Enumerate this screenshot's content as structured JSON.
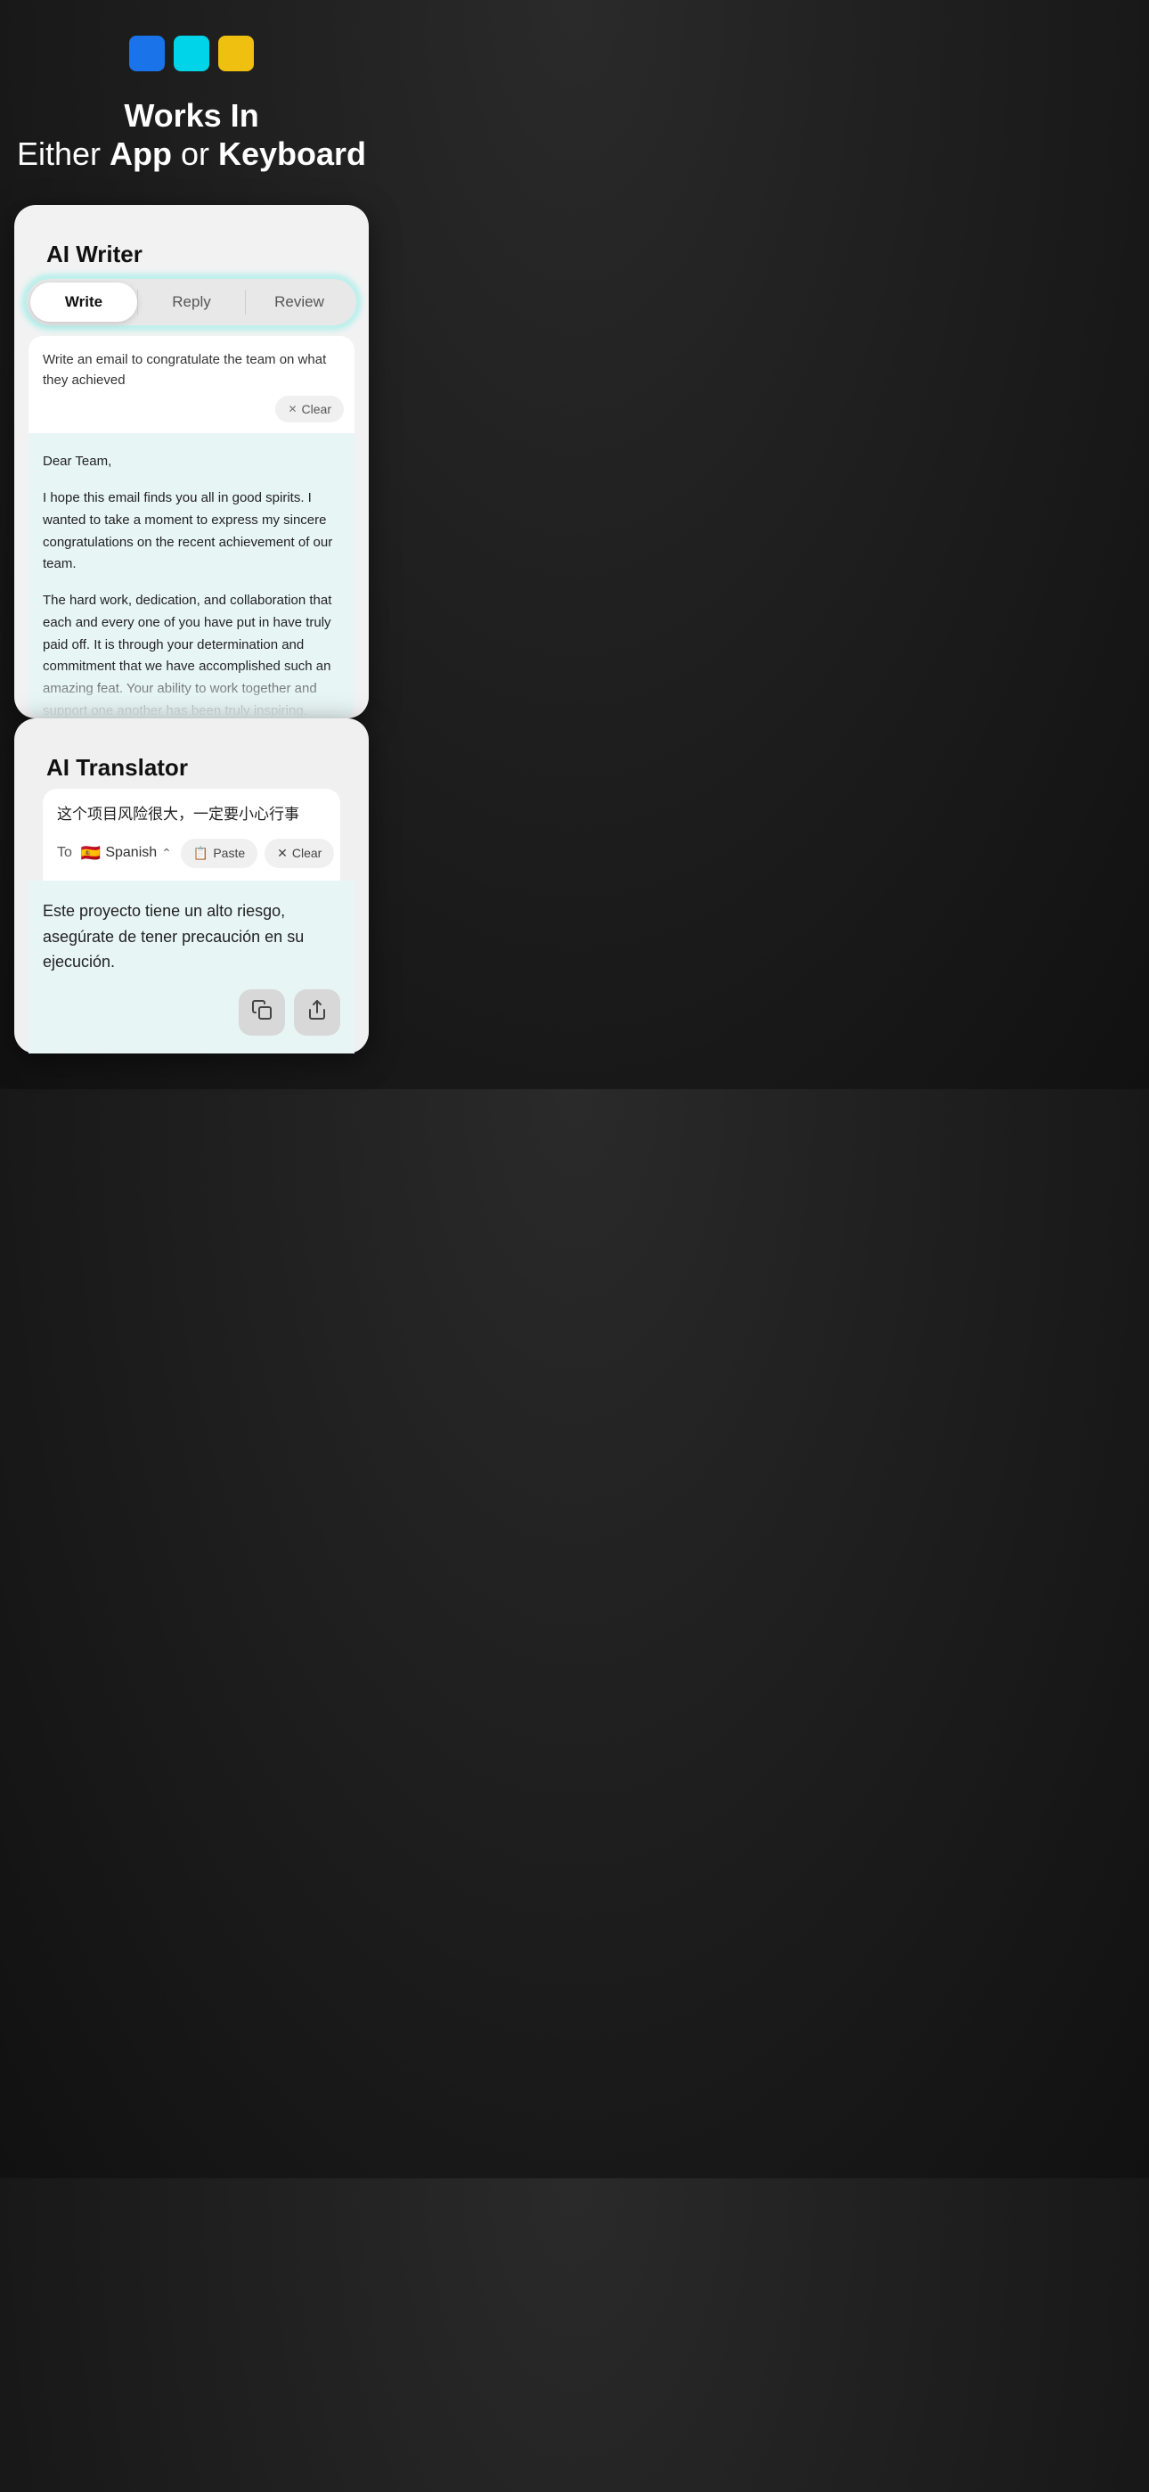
{
  "dots": [
    {
      "color": "blue",
      "label": "blue-dot"
    },
    {
      "color": "cyan",
      "label": "cyan-dot"
    },
    {
      "color": "yellow",
      "label": "yellow-dot"
    }
  ],
  "hero": {
    "line1": "Works In",
    "line2_pre": "Either ",
    "line2_app": "App",
    "line2_mid": " or ",
    "line2_keyboard": "Keyboard"
  },
  "ai_writer": {
    "title": "AI Writer",
    "tabs": [
      {
        "label": "Write",
        "active": true
      },
      {
        "label": "Reply",
        "active": false
      },
      {
        "label": "Review",
        "active": false
      }
    ],
    "prompt": "Write an email to congratulate the team on what they achieved",
    "clear_label": "Clear",
    "email_content": {
      "greeting": "Dear Team,",
      "para1": "I hope this email finds you all in good spirits. I wanted to take a moment to express my sincere congratulations on the recent achievement of our team.",
      "para2": "The hard work, dedication, and collaboration that each and every one of you have put in have truly paid off. It is through your determination and commitment that we have accomplished such an amazing feat. Your ability to work together and support one another has been truly inspiring."
    }
  },
  "ai_translator": {
    "title": "AI Translator",
    "source_text": "这个项目风险很大，一定要小心行事",
    "to_label": "To",
    "language": "Spanish",
    "flag": "🇪🇸",
    "paste_label": "Paste",
    "clear_label": "Clear",
    "translated_text": "Este proyecto tiene un alto riesgo, asegúrate de tener precaución en su ejecución.",
    "copy_icon": "📋",
    "share_icon": "⬆"
  }
}
